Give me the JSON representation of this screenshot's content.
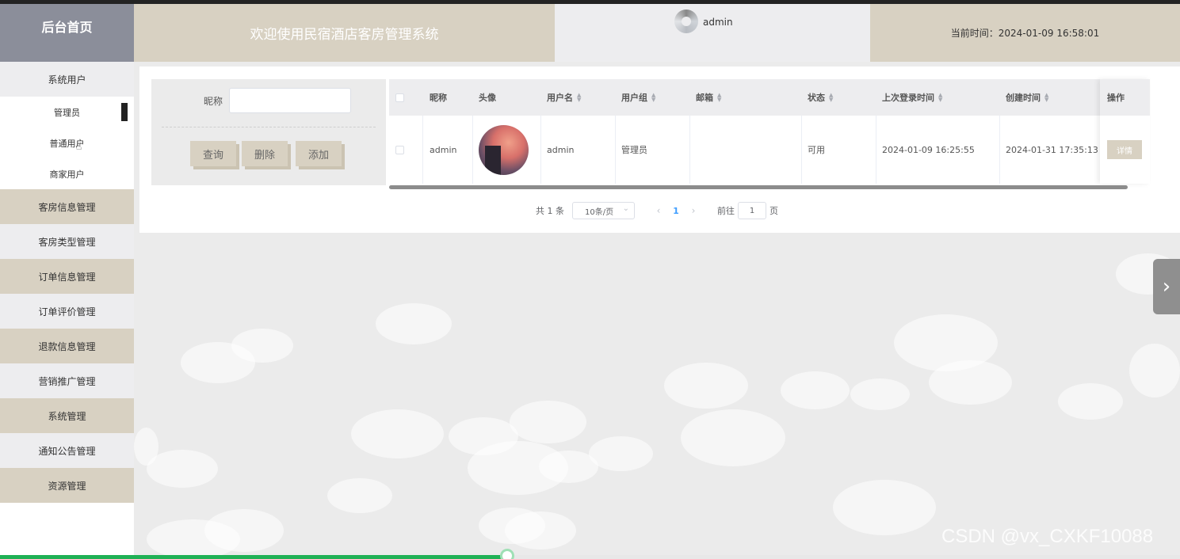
{
  "header": {
    "brand": "后台首页",
    "title": "欢迎使用民宿酒店客房管理系统",
    "username": "admin",
    "time_label": "当前时间：2024-01-09 16:58:01"
  },
  "sidebar": {
    "group_title": "系统用户",
    "sub_items": [
      "管理员",
      "普通用户",
      "商家用户"
    ],
    "items": [
      "客房信息管理",
      "客房类型管理",
      "订单信息管理",
      "订单评价管理",
      "退款信息管理",
      "营销推广管理",
      "系统管理",
      "通知公告管理",
      "资源管理"
    ]
  },
  "search": {
    "label": "昵称",
    "value": "",
    "buttons": {
      "query": "查询",
      "delete": "删除",
      "add": "添加"
    }
  },
  "table": {
    "headers": {
      "nickname": "昵称",
      "avatar": "头像",
      "username": "用户名",
      "group": "用户组",
      "email": "邮箱",
      "status": "状态",
      "last_login": "上次登录时间",
      "created": "创建时间",
      "action": "操作"
    },
    "rows": [
      {
        "nickname": "admin",
        "username": "admin",
        "group": "管理员",
        "email": "",
        "status": "可用",
        "last_login": "2024-01-09 16:25:55",
        "created": "2024-01-31 17:35:13",
        "action_label": "详情"
      }
    ]
  },
  "pagination": {
    "total": "共 1 条",
    "page_size": "10条/页",
    "current_page": "1",
    "goto_label": "前往",
    "goto_value": "1",
    "goto_suffix": "页"
  },
  "watermark": "CSDN @vx_CXKF10088",
  "video_progress": 0.43,
  "colors": {
    "tan": "#d8d1c2",
    "brand_bg": "#8b8e9a",
    "accent": "#409eff",
    "progress": "#1fb155"
  }
}
